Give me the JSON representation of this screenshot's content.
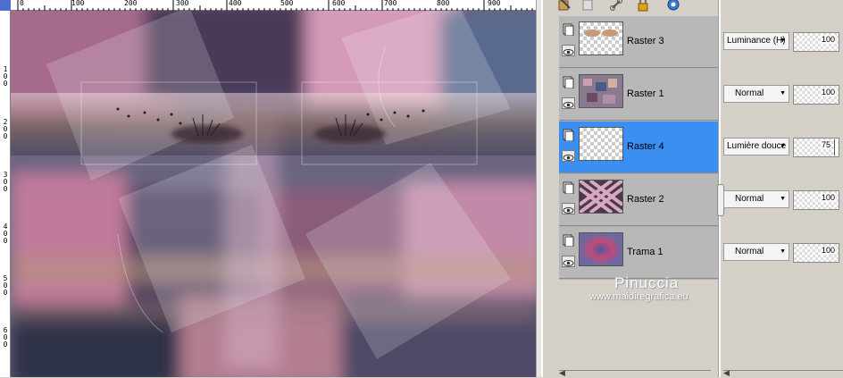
{
  "rulers": {
    "top_ticks": [
      "0",
      "100",
      "200",
      "300",
      "400",
      "500",
      "600",
      "700",
      "800",
      "900"
    ],
    "left_ticks": [
      "1\n0\n0",
      "2\n0\n0",
      "3\n0\n0",
      "4\n0\n0",
      "5\n0\n0",
      "6\n0\n0"
    ]
  },
  "layers": [
    {
      "name": "Raster 3",
      "blend_mode": "Luminance (H)",
      "opacity": "100",
      "selected": false,
      "thumb": "lips-icon"
    },
    {
      "name": "Raster 1",
      "blend_mode": "Normal",
      "opacity": "100",
      "selected": false,
      "thumb": "mosaic-icon"
    },
    {
      "name": "Raster 4",
      "blend_mode": "Lumière douce",
      "opacity": "75",
      "selected": true,
      "thumb": "transparent"
    },
    {
      "name": "Raster 2",
      "blend_mode": "Normal",
      "opacity": "100",
      "selected": false,
      "thumb": "weave-icon"
    },
    {
      "name": "Trama 1",
      "blend_mode": "Normal",
      "opacity": "100",
      "selected": false,
      "thumb": "radial-icon"
    }
  ],
  "watermark": {
    "name": "Pinuccia",
    "url": "www.maidiregrafica.eu"
  },
  "colors": {
    "selected": "#3b8ff2",
    "panel": "#d4d0c8"
  }
}
